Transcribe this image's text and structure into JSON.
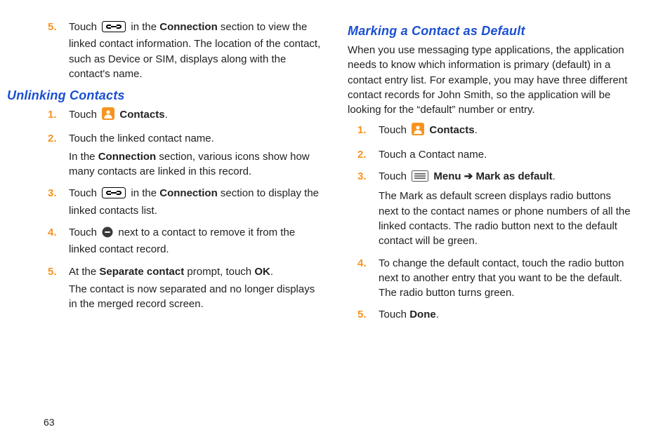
{
  "left": {
    "continued_step": {
      "pre": "Touch ",
      "mid": " in the ",
      "bold1": "Connection",
      "post": " section to view the linked contact information. The location of the contact, such as Device or SIM, displays along with the contact's name."
    },
    "heading": "Unlinking Contacts",
    "steps": [
      {
        "pre": "Touch ",
        "bold": "Contacts",
        "post": "."
      },
      {
        "line": "Touch the linked contact name.",
        "sub_pre": "In the ",
        "sub_bold": "Connection",
        "sub_post": " section, various icons show how many contacts are linked in this record."
      },
      {
        "pre": "Touch ",
        "mid": " in the ",
        "bold1": "Connection",
        "post": " section to display the linked contacts list."
      },
      {
        "pre": "Touch ",
        "post": " next to a contact to remove it from the linked contact record."
      },
      {
        "pre": "At the ",
        "bold1": "Separate contact",
        "mid": " prompt, touch ",
        "bold2": "OK",
        "post": ".",
        "sub": "The contact is now separated and no longer displays in the merged record screen."
      }
    ]
  },
  "right": {
    "heading": "Marking a Contact as Default",
    "intro": "When you use messaging type applications, the application needs to know which information is primary (default) in a contact entry list. For example, you may have three different contact records for John Smith, so the application will be looking for the “default” number or entry.",
    "steps": [
      {
        "pre": "Touch ",
        "bold": "Contacts",
        "post": "."
      },
      {
        "line": "Touch a Contact name."
      },
      {
        "pre": "Touch ",
        "bold1": "Menu",
        "arrow": " ➔ ",
        "bold2": "Mark as default",
        "post": ".",
        "sub": "The Mark as default screen displays radio buttons next to the contact names or phone numbers of all the linked contacts. The radio button next to the default contact will be green."
      },
      {
        "line": "To change the default contact, touch the radio button next to another entry that you want to be the default. The radio button turns green."
      },
      {
        "pre": "Touch ",
        "bold": "Done",
        "post": "."
      }
    ]
  },
  "page_number": "63"
}
